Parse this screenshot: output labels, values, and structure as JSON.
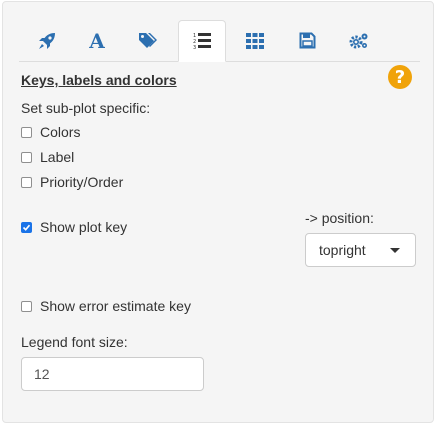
{
  "tabs": [
    {
      "icon": "rocket-icon",
      "active": false
    },
    {
      "icon": "font-icon",
      "letter": "A",
      "active": false
    },
    {
      "icon": "tags-icon",
      "active": false
    },
    {
      "icon": "ordered-list-icon",
      "active": true
    },
    {
      "icon": "grid-icon",
      "active": false
    },
    {
      "icon": "save-icon",
      "active": false
    },
    {
      "icon": "gears-icon",
      "active": false
    }
  ],
  "colors": {
    "accent": "#2c6fb0",
    "help": "#f0a30a",
    "checkbox_checked": "#1a73e8"
  },
  "section": {
    "title": "Keys, labels and colors",
    "help_glyph": "?",
    "subplot_label": "Set sub-plot specific:"
  },
  "checkboxes": {
    "colors": {
      "label": "Colors",
      "checked": false
    },
    "label": {
      "label": "Label",
      "checked": false
    },
    "priority": {
      "label": "Priority/Order",
      "checked": false
    },
    "show_plot_key": {
      "label": "Show plot key",
      "checked": true
    },
    "show_error_key": {
      "label": "Show error estimate key",
      "checked": false
    }
  },
  "position": {
    "label": "-> position:",
    "value": "topright"
  },
  "legend_font": {
    "label": "Legend font size:",
    "value": "12"
  }
}
